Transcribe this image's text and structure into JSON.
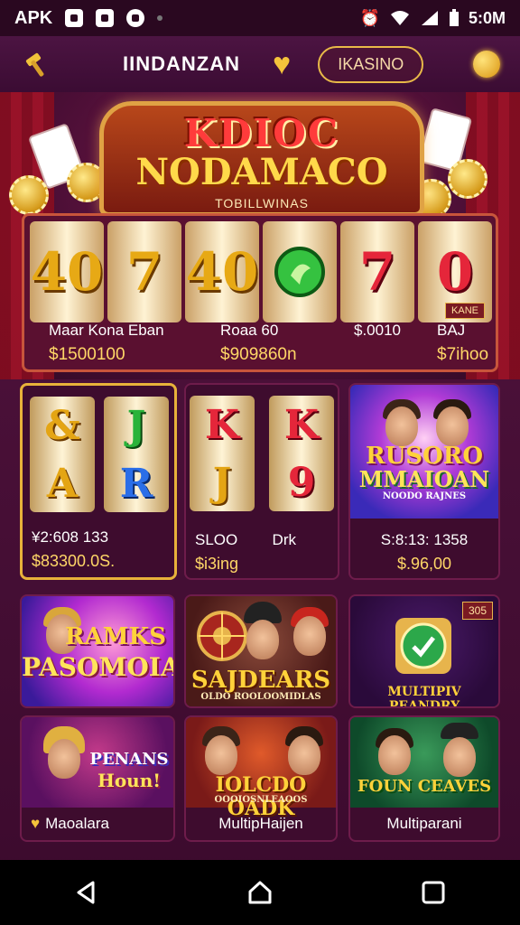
{
  "status_bar": {
    "carrier": "APK",
    "clock": "5:0M"
  },
  "app_bar": {
    "title": "IINDANZAN",
    "pill_label": "IKASINO"
  },
  "hero": {
    "marquee_line1": "KDIOC",
    "marquee_line2": "NODAMACO",
    "marquee_sub": "TOBILLWINAS",
    "reels": [
      "40",
      "7",
      "40",
      "",
      "7",
      "0"
    ],
    "reel_tag": "KANE",
    "info": [
      {
        "label": "Maar Kona Eban",
        "value": "$1500100"
      },
      {
        "label": "Roaa 60",
        "value": "$909860n"
      },
      {
        "label": "$.0010",
        "value": ""
      },
      {
        "label": "BAJ",
        "value": "$7ihoo"
      }
    ]
  },
  "row2": [
    {
      "symbols_top": [
        "&",
        "J"
      ],
      "symbols_bottom": [
        "A",
        "R"
      ],
      "label": "¥2:608 133",
      "value": "$83300.0S."
    },
    {
      "symbols_top": [
        "K",
        "K"
      ],
      "symbols_bottom": [
        "J",
        "9"
      ],
      "label": "SLOO",
      "label2": "Drk",
      "value": "$i3ing"
    },
    {
      "title1": "RUSORO",
      "title2": "MMAIOAN",
      "subtitle": "NOODO RAJNES",
      "label": "S:8:13: 1358",
      "value": "$.96,00"
    }
  ],
  "row3": [
    {
      "title1": "RAMKS",
      "title2": "PASOMOIA"
    },
    {
      "title1": "SAJDEARS",
      "subtitle": "OLDO ROOLOOMIDLAS"
    },
    {
      "badge": "305",
      "title1": "MULTIPIV PEANDRY"
    }
  ],
  "row4": [
    {
      "title1": "PENANS",
      "title2": "Houn!",
      "caption": "Maoalara"
    },
    {
      "title1": "IOLCDO OADK",
      "subtitle": "OOOIOSNLEAOOS",
      "caption": "MultipHaijen"
    },
    {
      "title1": "FOUN CEAVES",
      "caption": "Multiparani"
    }
  ],
  "colors": {
    "background": "#3b0a2d",
    "accent_gold": "#f0c23a",
    "value_gold": "#ffd767",
    "reel_red": "#e5263a"
  }
}
